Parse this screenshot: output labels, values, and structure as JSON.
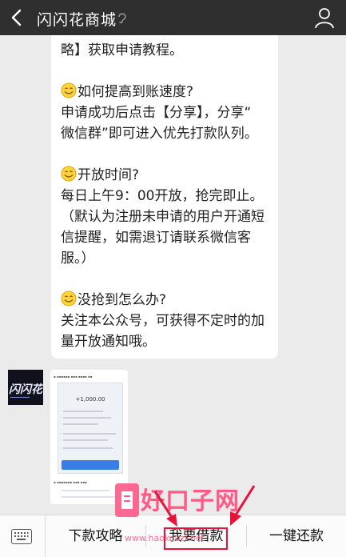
{
  "header": {
    "title": "闪闪花商城"
  },
  "message": {
    "lines": [
      "略】获取申请教程。",
      "",
      "如何提高到账速度?",
      "申请成功后点击【分享】，分享“",
      "微信群”即可进入优先打款队列。",
      "",
      "开放时间?",
      "每日上午9：00开放，抢完即止。",
      "（默认为注册未申请的用户开通短",
      "信提醒，如需退订请联系微信客",
      "服。）",
      "",
      "没抢到怎么办?",
      "关注本公众号，可获得不定时的加",
      "量开放通知哦。"
    ],
    "emoji_icon": "smile-emoji-icon"
  },
  "avatar": {
    "text": "闪闪花"
  },
  "image_card": {
    "amount": "+1,000.00"
  },
  "menu": {
    "items": [
      {
        "label": "下款攻略"
      },
      {
        "label": "我要借款"
      },
      {
        "label": "一键还款"
      }
    ]
  },
  "watermark": {
    "text": "好口子网",
    "url": "www.haokouzi.net"
  },
  "colors": {
    "header_bg": "#2f2f30",
    "highlight": "#e8123a",
    "watermark": "#ff5a86"
  }
}
